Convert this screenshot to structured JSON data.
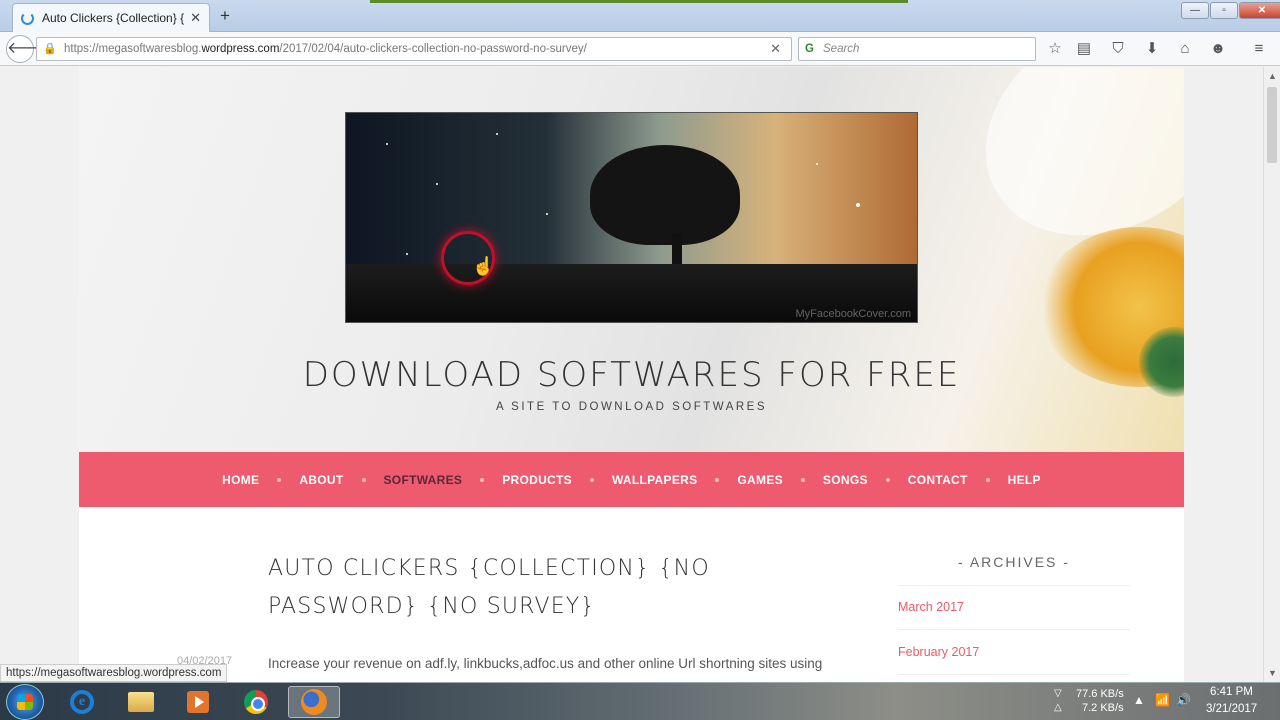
{
  "browser": {
    "tab_title": "Auto Clickers {Collection} {...",
    "tab_close": "✕",
    "new_tab": "+",
    "url_prefix": "https://megasoftwaresblog.",
    "url_domain": "wordpress.com",
    "url_path": "/2017/02/04/auto-clickers-collection-no-password-no-survey/",
    "search_placeholder": "Search",
    "status_link": "https://megasoftwaresblog.wordpress.com",
    "window_controls": {
      "minimize": "—",
      "maximize": "▫",
      "close": "✕"
    }
  },
  "site": {
    "title": "DOWNLOAD SOFTWARES FOR FREE",
    "tagline": "A SITE TO DOWNLOAD SOFTWARES",
    "banner_watermark": "MyFacebookCover.com",
    "menu": [
      {
        "label": "HOME"
      },
      {
        "label": "ABOUT"
      },
      {
        "label": "SOFTWARES",
        "active": true
      },
      {
        "label": "PRODUCTS"
      },
      {
        "label": "WALLPAPERS"
      },
      {
        "label": "GAMES"
      },
      {
        "label": "SONGS"
      },
      {
        "label": "CONTACT"
      },
      {
        "label": "HELP"
      }
    ],
    "accent_color": "#ee5a6e"
  },
  "post": {
    "title_line1": "AUTO CLICKERS {COLLECTION} {NO",
    "title_line2": "PASSWORD} {NO SURVEY}",
    "date": "04/02/2017",
    "body": "Increase your revenue on adf.ly, linkbucks,adfoc.us and other online Url shortning sites using"
  },
  "sidebar": {
    "widget_title": "- ARCHIVES -",
    "archives": [
      "March 2017",
      "February 2017"
    ]
  },
  "taskbar": {
    "net_down": "77.6 KB/s",
    "net_up": "7.2 KB/s",
    "time": "6:41 PM",
    "date": "3/21/2017"
  },
  "icons": [
    "back-icon",
    "lock-icon",
    "star-icon",
    "reading-list-icon",
    "pocket-icon",
    "download-icon",
    "home-icon",
    "chat-icon",
    "hamburger-menu-icon",
    "start-orb-icon",
    "ie-icon",
    "folder-icon",
    "media-player-icon",
    "chrome-icon",
    "firefox-icon"
  ]
}
